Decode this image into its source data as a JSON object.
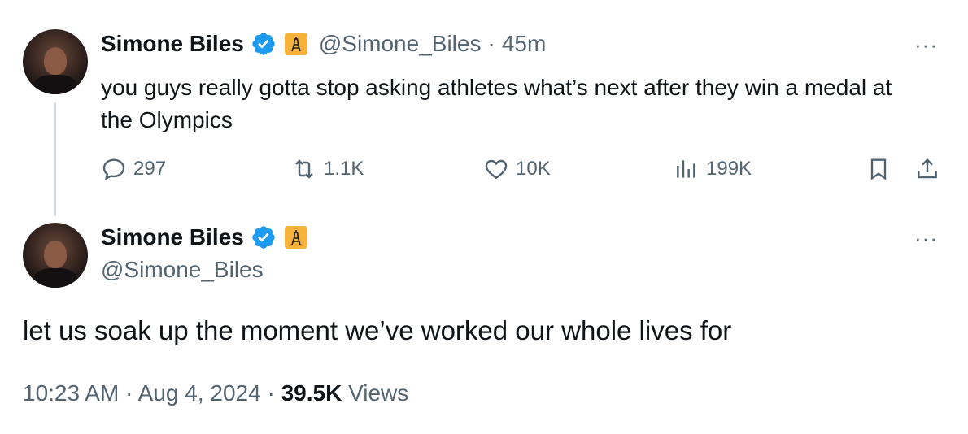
{
  "reply_tweet": {
    "author_name": "Simone Biles",
    "handle": "@Simone_Biles",
    "separator": "·",
    "time_ago": "45m",
    "text": "you guys really gotta stop asking athletes what’s next after they win a medal at the Olympics",
    "more_label": "···",
    "stats": {
      "replies": "297",
      "reposts": "1.1K",
      "likes": "10K",
      "views": "199K"
    },
    "icons": [
      "reply-icon",
      "repost-icon",
      "like-icon",
      "views-icon",
      "bookmark-icon",
      "share-icon"
    ]
  },
  "main_tweet": {
    "author_name": "Simone Biles",
    "handle": "@Simone_Biles",
    "more_label": "···",
    "text": "let us soak up the moment we’ve worked our whole lives for",
    "time": "10:23 AM",
    "separator": "·",
    "date": "Aug 4, 2024",
    "views_count": "39.5K",
    "views_label": "Views"
  },
  "colors": {
    "verified": "#1d9bf0",
    "flag_bg": "#f6b23b",
    "secondary_text": "#536471",
    "thread_line": "#cfd9de"
  }
}
